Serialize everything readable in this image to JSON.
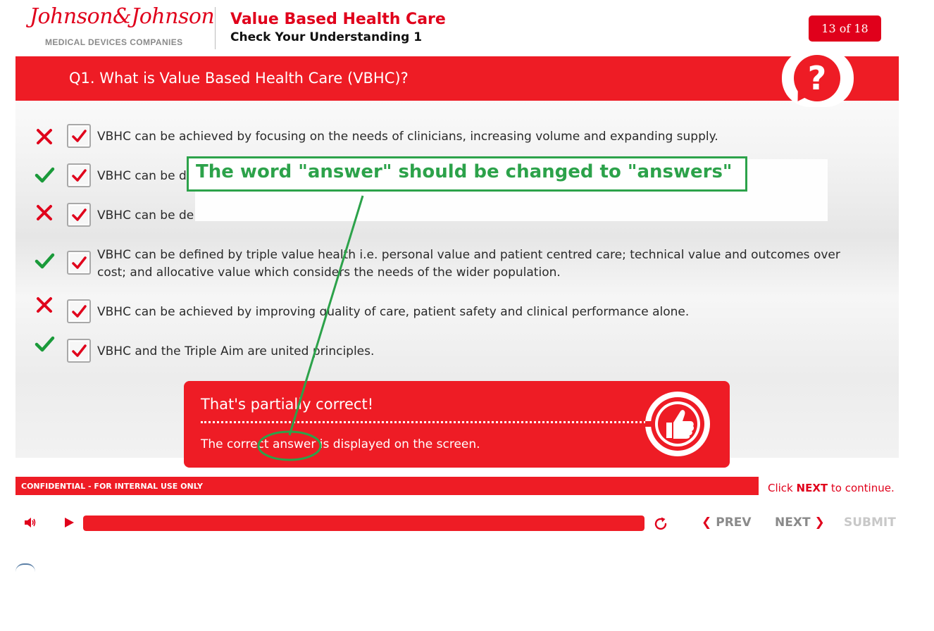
{
  "header": {
    "logo_text": "Johnson&Johnson",
    "logo_subtitle": "MEDICAL DEVICES COMPANIES",
    "course_title": "Value Based Health Care",
    "course_subtitle": "Check Your Understanding 1",
    "page_counter": "13 of 18"
  },
  "question": {
    "text": "Q1. What is Value Based Health Care (VBHC)?",
    "help_icon": "question-mark-icon"
  },
  "answers": [
    {
      "result": "incorrect",
      "checked": true,
      "text": "VBHC can be achieved by focusing on the needs of clinicians, increasing volume and expanding supply."
    },
    {
      "result": "correct",
      "checked": true,
      "text": "VBHC can be de"
    },
    {
      "result": "incorrect",
      "checked": true,
      "text": "VBHC can be de"
    },
    {
      "result": "correct",
      "checked": true,
      "text_line1": "VBHC can be defined by triple value health i.e. personal value and patient centred care; technical value and outcomes over",
      "text_line2": "cost; and allocative value which considers the needs of the wider population."
    },
    {
      "result": "incorrect",
      "checked": true,
      "text": "VBHC can be achieved by improving quality of care, patient safety and clinical performance alone."
    },
    {
      "result": "correct",
      "checked": true,
      "text": "VBHC and the Triple Aim are united principles."
    }
  ],
  "feedback": {
    "title": "That's partially correct!",
    "body": "The correct answer is displayed on the screen.",
    "icon": "thumbs-up-icon"
  },
  "footer": {
    "confidential": "CONFIDENTIAL - FOR INTERNAL USE ONLY",
    "continue_prefix": "Click ",
    "continue_keyword": "NEXT",
    "continue_suffix": " to continue."
  },
  "player": {
    "progress_percent": 100,
    "prev_label": "PREV",
    "next_label": "NEXT",
    "submit_label": "SUBMIT"
  },
  "annotation": {
    "comment": "The word \"answer\" should be changed to \"answers\"",
    "color": "#2ca24a"
  },
  "colors": {
    "brand_red": "#ee1c25",
    "correct_green": "#1a9a3a",
    "incorrect_red": "#e0001b"
  }
}
